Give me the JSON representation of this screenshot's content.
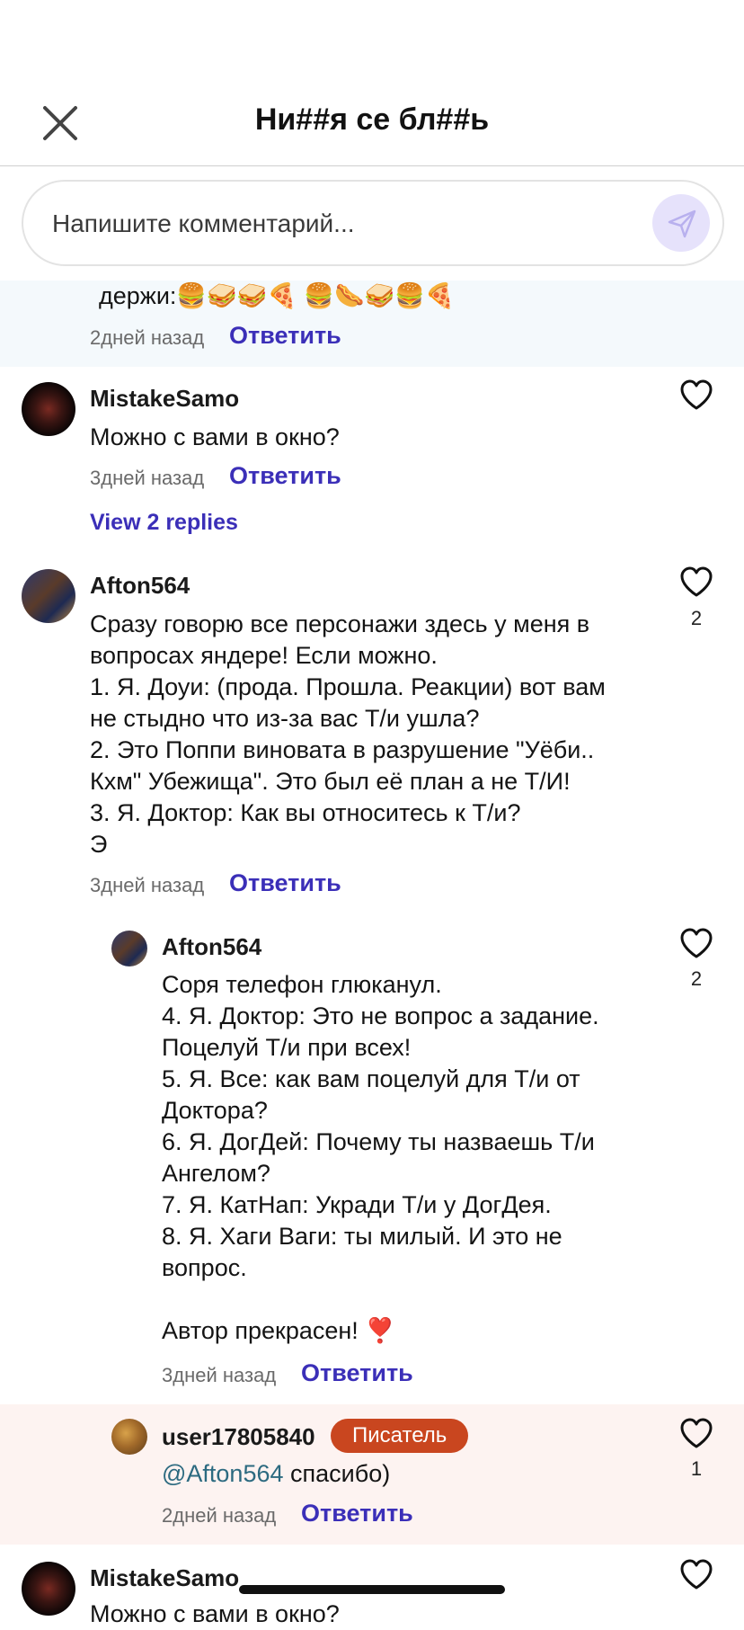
{
  "header": {
    "title": "Ни##я се бл##ь"
  },
  "compose": {
    "placeholder": "Напишите комментарий..."
  },
  "colors": {
    "accent": "#3b2fb8",
    "badge": "#c9461f",
    "send_bg": "#e6e2fb",
    "highlight_blue": "#f4f9fc",
    "highlight_pink": "#fdf3f1"
  },
  "icons": {
    "close": "close-icon",
    "send": "send-icon",
    "like": "heart-icon"
  },
  "comments": [
    {
      "text": "держи:🍔🥪🥪🍕 🍔🌭🥪🍔🍕",
      "time": "2дней назад",
      "reply": "Ответить"
    },
    {
      "user": "MistakeSamo",
      "text": "Можно с вами в окно?",
      "time": "3дней назад",
      "reply": "Ответить",
      "view_replies": "View 2 replies"
    },
    {
      "user": "Afton564",
      "text": "Сразу говорю все персонажи здесь у меня в\nвопросах яндере! Если можно.\n1. Я. Доуи: (прода. Прошла. Реакции) вот вам\nне стыдно что из-за вас Т/и ушла?\n2. Это Поппи виновата в разрушение \"Уёби..\nКхм\" Убежища\". Это был её план а не Т/И!\n3. Я. Доктор: Как вы относитесь к Т/и?\nЭ",
      "time": "3дней назад",
      "reply": "Ответить",
      "likes": "2"
    },
    {
      "user": "Afton564",
      "text": "Соря телефон глюканул.\n4. Я. Доктор: Это не вопрос а задание.\nПоцелуй Т/и при всех!\n5. Я. Все: как вам поцелуй для Т/и от\nДоктора?\n6. Я. ДогДей: Почему ты назваешь Т/и\nАнгелом?\n7. Я. КатНап: Укради Т/и у ДогДея.\n8. Я. Хаги Ваги: ты милый. И это не\nвопрос.\n\nАвтор прекрасен! ❣️",
      "time": "3дней назад",
      "reply": "Ответить",
      "likes": "2"
    },
    {
      "user": "user17805840",
      "badge": "Писатель",
      "mention": "@Afton564",
      "text": " спасибо)",
      "time": "2дней назад",
      "reply": "Ответить",
      "likes": "1"
    },
    {
      "user": "MistakeSamo",
      "text": "Можно с вами в окно?"
    }
  ]
}
